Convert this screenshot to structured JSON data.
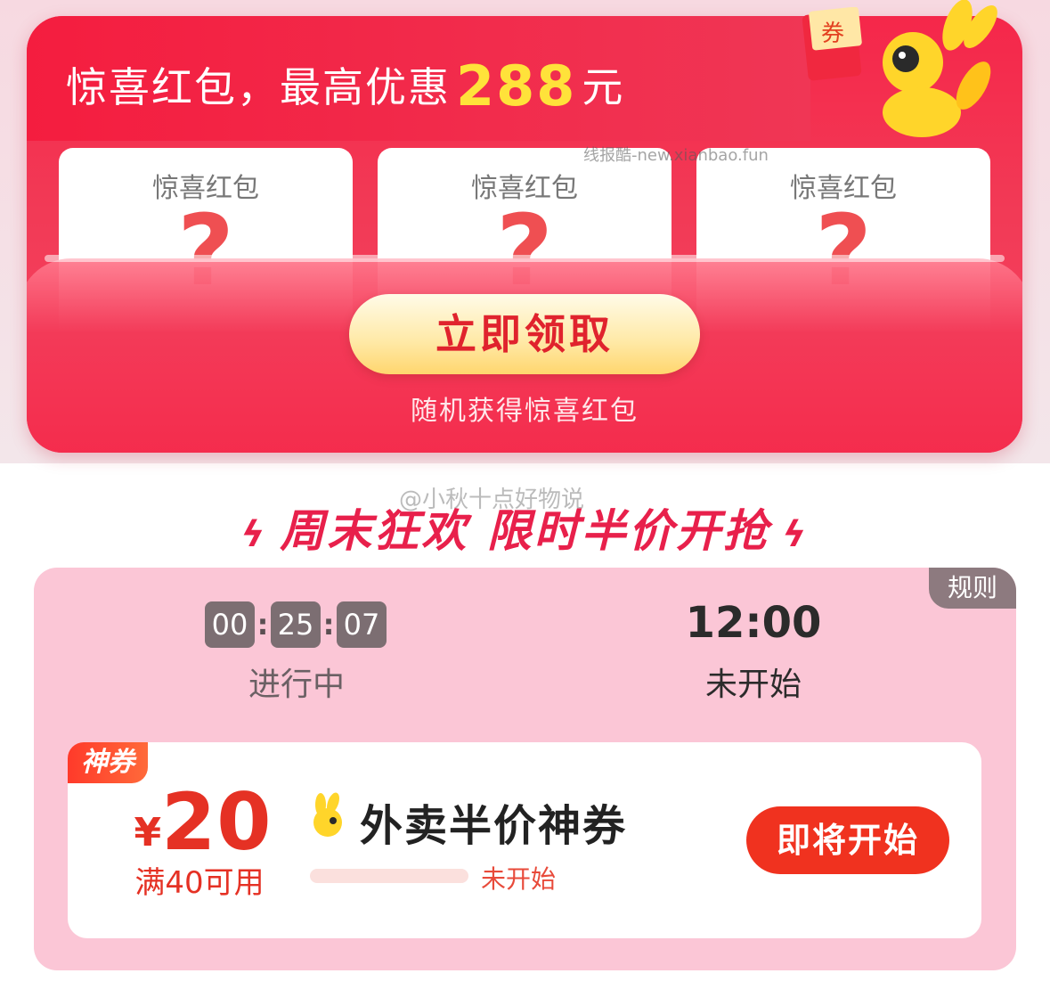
{
  "envelope": {
    "title_prefix": "惊喜红包，最高优惠",
    "title_amount": "288",
    "title_suffix": "元",
    "cards": [
      {
        "label": "惊喜红包",
        "mark": "?"
      },
      {
        "label": "惊喜红包",
        "mark": "?"
      },
      {
        "label": "惊喜红包",
        "mark": "?"
      }
    ],
    "claim_button": "立即领取",
    "subtitle": "随机获得惊喜红包",
    "coupon_tag": "券"
  },
  "watermarks": {
    "site": "线报酷-new.xianbao.fun",
    "weibo": "@小秋十点好物说"
  },
  "section": {
    "title": "周末狂欢 限时半价开抢"
  },
  "sale": {
    "rules_label": "规则",
    "countdown": {
      "h": "00",
      "m": "25",
      "s": "07",
      "sep": ":"
    },
    "current_status": "进行中",
    "next_time": "12:00",
    "next_status": "未开始"
  },
  "coupon": {
    "badge": "神券",
    "currency": "¥",
    "amount": "20",
    "condition": "满40可用",
    "title": "外卖半价神券",
    "progress": 0,
    "progress_status": "未开始",
    "button": "即将开始"
  },
  "colors": {
    "brand_red": "#f5274a",
    "amount_yellow": "#ffe23a",
    "panel_pink": "#fbc6d6",
    "button_red": "#f0321f"
  }
}
